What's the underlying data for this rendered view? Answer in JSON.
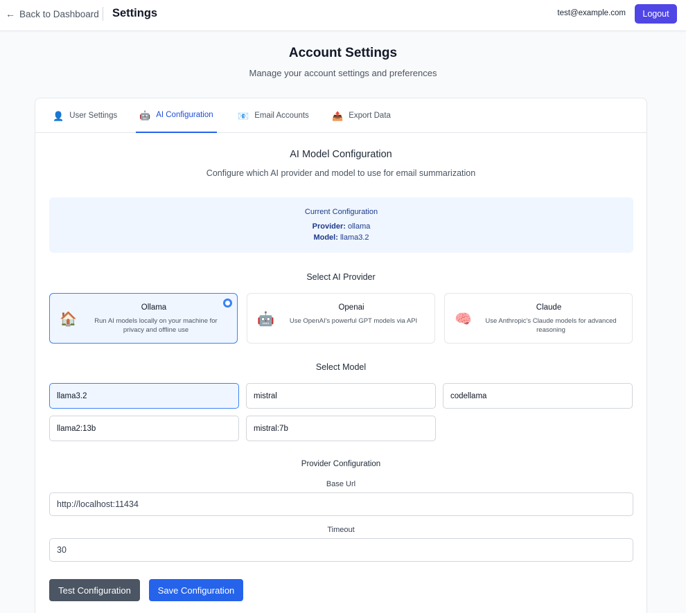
{
  "header": {
    "back_label": "Back to Dashboard",
    "title": "Settings",
    "user_email": "test@example.com",
    "logout_label": "Logout"
  },
  "page": {
    "heading": "Account Settings",
    "subheading": "Manage your account settings and preferences"
  },
  "tabs": [
    {
      "label": "User Settings",
      "icon": "👤",
      "active": false
    },
    {
      "label": "AI Configuration",
      "icon": "🤖",
      "active": true
    },
    {
      "label": "Email Accounts",
      "icon": "📧",
      "active": false
    },
    {
      "label": "Export Data",
      "icon": "📤",
      "active": false
    }
  ],
  "ai_config": {
    "title": "AI Model Configuration",
    "description": "Configure which AI provider and model to use for email summarization",
    "current": {
      "label": "Current Configuration",
      "provider_key": "Provider:",
      "provider_value": "ollama",
      "model_key": "Model:",
      "model_value": "llama3.2"
    },
    "provider_section_title": "Select AI Provider",
    "providers": [
      {
        "name": "Ollama",
        "desc": "Run AI models locally on your machine for privacy and offline use",
        "icon": "🏠",
        "selected": true
      },
      {
        "name": "Openai",
        "desc": "Use OpenAI's powerful GPT models via API",
        "icon": "🤖",
        "selected": false
      },
      {
        "name": "Claude",
        "desc": "Use Anthropic's Claude models for advanced reasoning",
        "icon": "🧠",
        "selected": false
      }
    ],
    "model_section_title": "Select Model",
    "models": [
      "llama3.2",
      "mistral",
      "codellama",
      "llama2:13b",
      "mistral:7b"
    ],
    "selected_model": "llama3.2",
    "provider_config_title": "Provider Configuration",
    "base_url_label": "Base Url",
    "base_url_value": "http://localhost:11434",
    "timeout_label": "Timeout",
    "timeout_value": "30",
    "test_label": "Test Configuration",
    "save_label": "Save Configuration"
  },
  "colors": {
    "accent": "#2563eb",
    "logout": "#4f46e5",
    "secondary_button": "#4b5563",
    "info_bg": "#eff6ff"
  }
}
